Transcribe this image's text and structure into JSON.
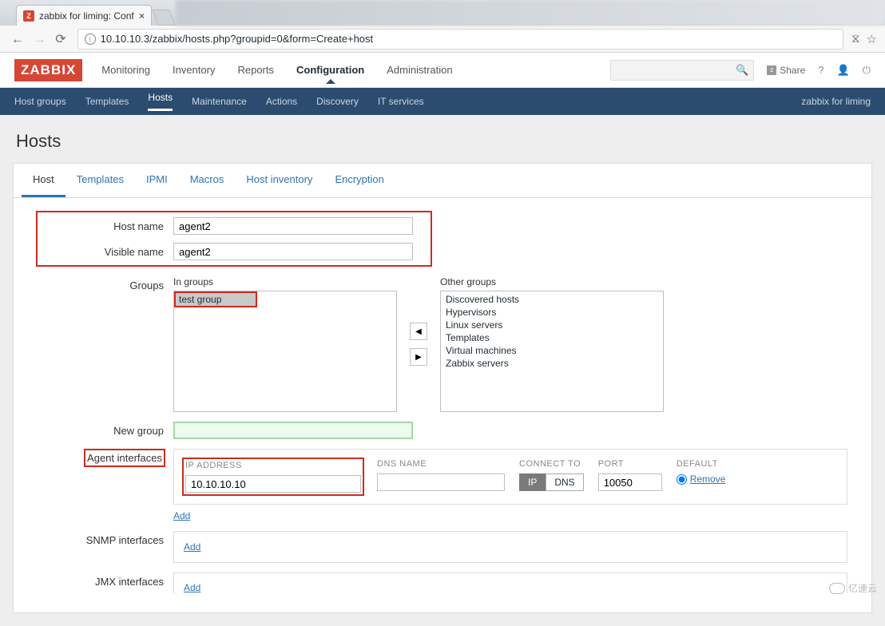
{
  "browser": {
    "tab_title": "zabbix for liming: Conf",
    "tab_close": "×",
    "url": "10.10.10.3/zabbix/hosts.php?groupid=0&form=Create+host"
  },
  "header": {
    "logo": "ZABBIX",
    "nav": [
      "Monitoring",
      "Inventory",
      "Reports",
      "Configuration",
      "Administration"
    ],
    "active": "Configuration",
    "share": "Share"
  },
  "subnav": {
    "items": [
      "Host groups",
      "Templates",
      "Hosts",
      "Maintenance",
      "Actions",
      "Discovery",
      "IT services"
    ],
    "active": "Hosts",
    "right": "zabbix for liming"
  },
  "page": {
    "title": "Hosts"
  },
  "tabs": {
    "items": [
      "Host",
      "Templates",
      "IPMI",
      "Macros",
      "Host inventory",
      "Encryption"
    ],
    "active": "Host"
  },
  "form": {
    "host_name_label": "Host name",
    "host_name_value": "agent2",
    "visible_name_label": "Visible name",
    "visible_name_value": "agent2",
    "groups_label": "Groups",
    "in_groups_label": "In groups",
    "other_groups_label": "Other groups",
    "in_groups": [
      "test group"
    ],
    "other_groups": [
      "Discovered hosts",
      "Hypervisors",
      "Linux servers",
      "Templates",
      "Virtual machines",
      "Zabbix servers"
    ],
    "new_group_label": "New group",
    "new_group_value": "",
    "agent_interfaces_label": "Agent interfaces",
    "snmp_interfaces_label": "SNMP interfaces",
    "jmx_interfaces_label": "JMX interfaces",
    "add_label": "Add",
    "iface": {
      "ip_label": "IP ADDRESS",
      "ip_value": "10.10.10.10",
      "dns_label": "DNS NAME",
      "dns_value": "",
      "connect_label": "CONNECT TO",
      "connect_ip": "IP",
      "connect_dns": "DNS",
      "port_label": "PORT",
      "port_value": "10050",
      "default_label": "DEFAULT",
      "remove_label": "Remove"
    }
  },
  "watermark": "亿速云"
}
